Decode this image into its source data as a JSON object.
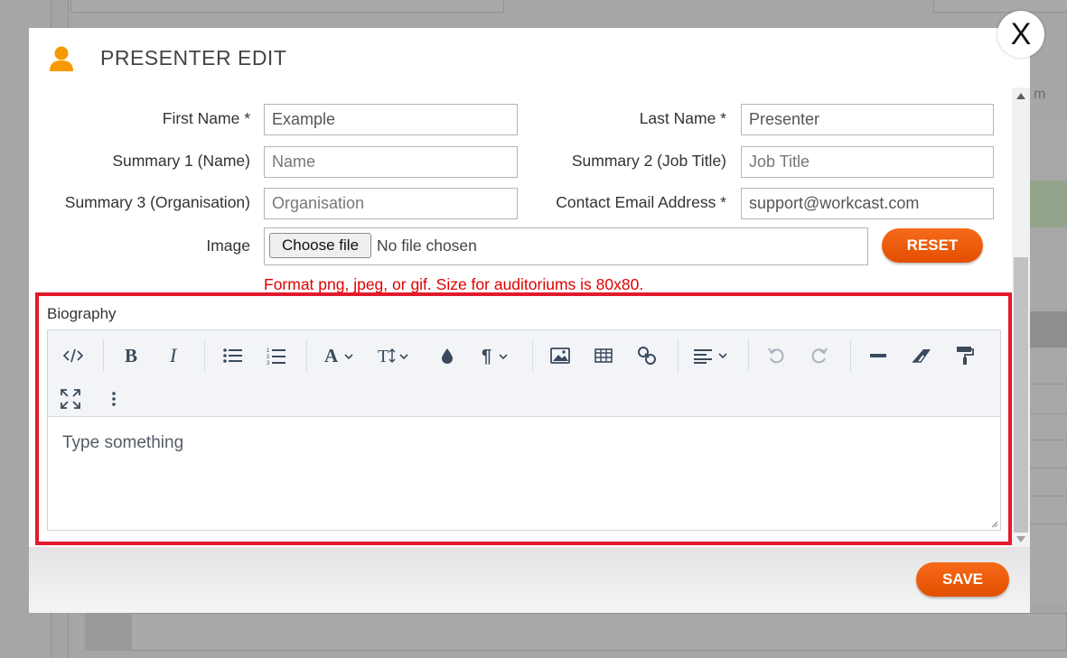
{
  "modal": {
    "title": "PRESENTER EDIT",
    "close_label": "X"
  },
  "background": {
    "right_fragment": "m"
  },
  "form": {
    "first_name": {
      "label": "First Name *",
      "value": "Example"
    },
    "last_name": {
      "label": "Last Name *",
      "value": "Presenter"
    },
    "summary1": {
      "label": "Summary 1 (Name)",
      "placeholder": "Name"
    },
    "summary2": {
      "label": "Summary 2 (Job Title)",
      "placeholder": "Job Title"
    },
    "summary3": {
      "label": "Summary 3 (Organisation)",
      "placeholder": "Organisation"
    },
    "email": {
      "label": "Contact Email Address *",
      "value": "support@workcast.com"
    },
    "image": {
      "label": "Image",
      "choose_label": "Choose file",
      "status": "No file chosen",
      "reset_label": "RESET",
      "format_note": "Format png, jpeg, or gif. Size for auditoriums is 80x80."
    }
  },
  "biography": {
    "label": "Biography",
    "placeholder": "Type something",
    "toolbar_icons": [
      "code-view-icon",
      "bold-icon",
      "italic-icon",
      "bullet-list-icon",
      "numbered-list-icon",
      "font-family-icon",
      "font-size-icon",
      "text-color-icon",
      "paragraph-style-icon",
      "insert-image-icon",
      "insert-table-icon",
      "insert-link-icon",
      "align-icon",
      "undo-icon",
      "redo-icon",
      "horizontal-rule-icon",
      "clear-format-icon",
      "format-painter-icon",
      "fullscreen-icon",
      "more-options-icon"
    ]
  },
  "footer": {
    "save_label": "SAVE"
  },
  "colors": {
    "accent": "#f26419",
    "highlight_border": "#e21a2c",
    "error_text": "#e00000",
    "person_icon": "#f59a00"
  }
}
